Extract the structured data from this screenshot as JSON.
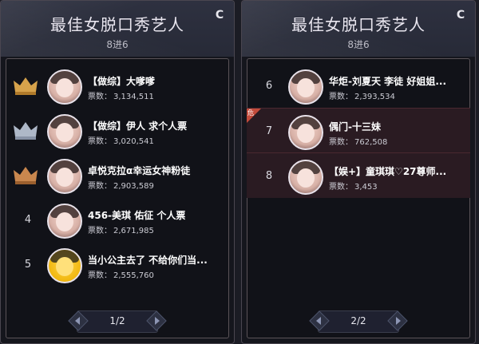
{
  "panels": [
    {
      "title": "最佳女脱口秀艺人",
      "subtitle": "8进6",
      "page": "1/2",
      "rows": [
        {
          "rank": "",
          "crown": "gold",
          "name": "【做综】大嗲嗲",
          "votes_label": "票数：",
          "votes": "3,134,511",
          "avatar": "portrait"
        },
        {
          "rank": "",
          "crown": "silver",
          "name": "【做综】伊人 求个人票",
          "votes_label": "票数：",
          "votes": "3,020,541",
          "avatar": "portrait"
        },
        {
          "rank": "",
          "crown": "bronze",
          "name": "卓悦克拉α幸运女神粉徒",
          "votes_label": "票数：",
          "votes": "2,903,589",
          "avatar": "portrait"
        },
        {
          "rank": "4",
          "crown": "",
          "name": "456-美琪 佑征 个人票",
          "votes_label": "票数：",
          "votes": "2,671,985",
          "avatar": "portrait"
        },
        {
          "rank": "5",
          "crown": "",
          "name": "当小公主去了 不给你们当...",
          "votes_label": "票数：",
          "votes": "2,555,760",
          "avatar": "cartoon"
        }
      ]
    },
    {
      "title": "最佳女脱口秀艺人",
      "subtitle": "8进6",
      "page": "2/2",
      "rows": [
        {
          "rank": "6",
          "crown": "",
          "name": "华炬-刘夏天 李徒 好姐姐...",
          "votes_label": "票数：",
          "votes": "2,393,534",
          "avatar": "portrait"
        },
        {
          "rank": "7",
          "crown": "",
          "name": "偶门-十三妹",
          "votes_label": "票数：",
          "votes": "762,508",
          "avatar": "portrait",
          "highlight": true,
          "corner_badge": "危"
        },
        {
          "rank": "8",
          "crown": "",
          "name": "【娱+】童琪琪♡27尊师...",
          "votes_label": "票数：",
          "votes": "3,453",
          "avatar": "portrait",
          "highlight": true
        }
      ]
    }
  ],
  "colors": {
    "gold": "#d6a24b",
    "silver": "#aeb8c8",
    "bronze": "#c9874e",
    "highlight_bg": "#2a1b22",
    "badge": "#c34b3b"
  },
  "icons": {
    "refresh": "refresh-icon",
    "prev": "chevron-left-icon",
    "next": "chevron-right-icon",
    "crown": "crown-icon"
  }
}
